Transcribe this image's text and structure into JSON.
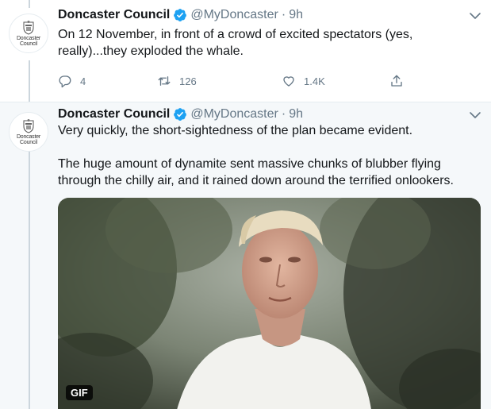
{
  "tweets": [
    {
      "author": "Doncaster Council",
      "handle": "@MyDoncaster",
      "time": "9h",
      "avatar_text": [
        "Doncaster",
        "Council"
      ],
      "text": "On 12 November, in front of a crowd of excited spectators (yes, really)...they exploded the whale.",
      "replies": "4",
      "retweets": "126",
      "likes": "1.4K"
    },
    {
      "author": "Doncaster Council",
      "handle": "@MyDoncaster",
      "time": "9h",
      "avatar_text": [
        "Doncaster",
        "Council"
      ],
      "text_1": "Very quickly, the short-sightedness of the plan became evident.",
      "text_2": "The huge amount of dynamite sent massive chunks of blubber flying through the chilly air, and it rained down around the terrified onlookers.",
      "media_badge": "GIF"
    }
  ],
  "separator": "·",
  "colors": {
    "text": "#14171a",
    "muted": "#657786",
    "verified": "#1da1f2",
    "thread_line": "#ccd6dd",
    "highlight_bg": "#f5f8fa"
  },
  "icons": [
    "verified-badge-icon",
    "chevron-down-icon",
    "reply-icon",
    "retweet-icon",
    "like-icon",
    "share-icon",
    "council-crest-icon"
  ]
}
